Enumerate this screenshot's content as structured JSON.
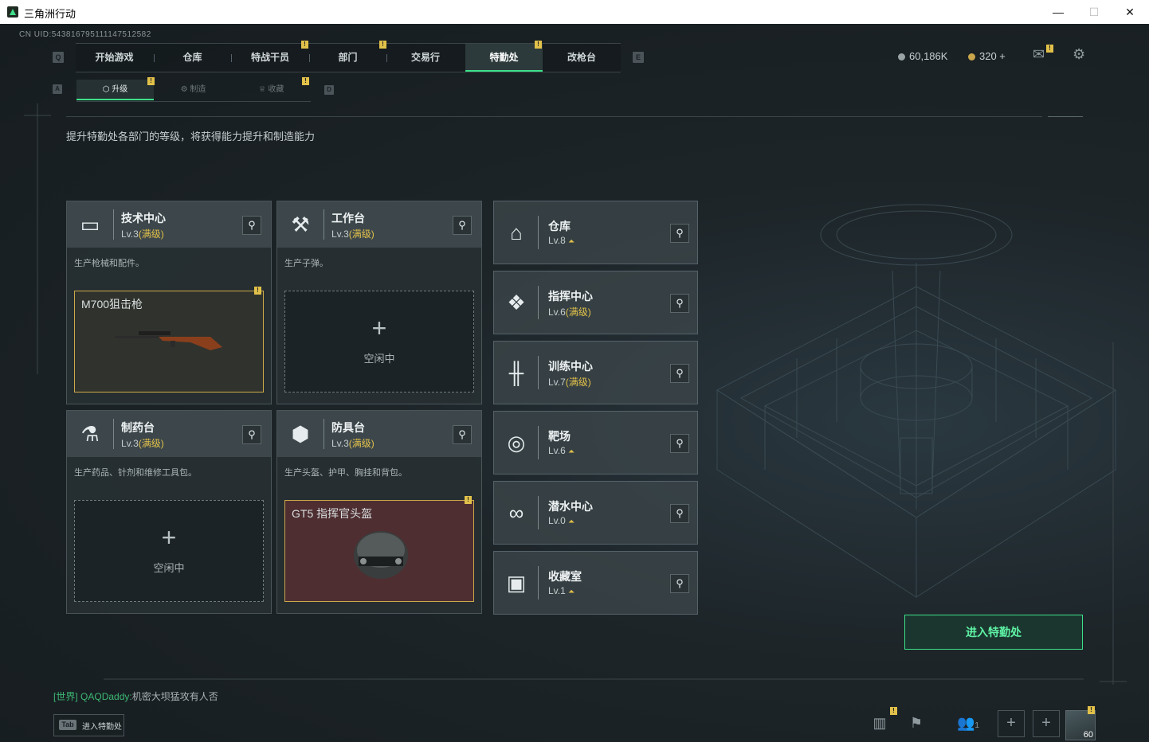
{
  "window": {
    "title": "三角洲行动",
    "minimize": "—",
    "maximize": "☐",
    "close": "✕"
  },
  "uid": "CN UID:543816795111147512582",
  "nav": {
    "left_key": "Q",
    "right_key": "E",
    "tabs": [
      {
        "label": "开始游戏"
      },
      {
        "label": "仓库"
      },
      {
        "label": "特战干员"
      },
      {
        "label": "部门"
      },
      {
        "label": "交易行"
      },
      {
        "label": "特勤处"
      },
      {
        "label": "改枪台"
      }
    ],
    "active": "特勤处"
  },
  "subnav": {
    "left_key": "A",
    "right_key": "D",
    "tabs": [
      {
        "label": "升级"
      },
      {
        "label": "制造"
      },
      {
        "label": "收藏"
      }
    ],
    "active": "升级"
  },
  "currency": {
    "silver": "60,186K",
    "gold": "320 +",
    "silver_color": "#9aa3a6",
    "gold_color": "#c9a64a"
  },
  "description": "提升特勤处各部门的等级，将获得能力提升和制造能力",
  "departments": [
    {
      "name": "技术中心",
      "level": "Lv.3",
      "max": "(满级)",
      "desc": "生产枪械和配件。",
      "icon": "computer-icon",
      "slot_state": "item",
      "slot_item": "M700狙击枪"
    },
    {
      "name": "工作台",
      "level": "Lv.3",
      "max": "(满级)",
      "desc": "生产子弹。",
      "icon": "tools-icon",
      "slot_state": "empty",
      "slot_idle": "空闲中"
    },
    {
      "name": "制药台",
      "level": "Lv.3",
      "max": "(满级)",
      "desc": "生产药品、针剂和维修工具包。",
      "icon": "microscope-icon",
      "slot_state": "empty",
      "slot_idle": "空闲中"
    },
    {
      "name": "防具台",
      "level": "Lv.3",
      "max": "(满级)",
      "desc": "生产头盔、护甲、胸挂和背包。",
      "icon": "armor-icon",
      "slot_state": "item",
      "slot_item": "GT5 指挥官头盔"
    }
  ],
  "facilities": [
    {
      "name": "仓库",
      "level": "Lv.8",
      "max": "",
      "icon": "warehouse-icon"
    },
    {
      "name": "指挥中心",
      "level": "Lv.6",
      "max": "(满级)",
      "icon": "command-icon"
    },
    {
      "name": "训练中心",
      "level": "Lv.7",
      "max": "(满级)",
      "icon": "dumbbell-icon"
    },
    {
      "name": "靶场",
      "level": "Lv.6",
      "max": "",
      "icon": "target-icon"
    },
    {
      "name": "潜水中心",
      "level": "Lv.0",
      "max": "",
      "icon": "diving-mask-icon"
    },
    {
      "name": "收藏室",
      "level": "Lv.1",
      "max": "",
      "icon": "collection-icon"
    }
  ],
  "enter_button": "进入特勤处",
  "chat": {
    "channel": "[世界]",
    "user": "QAQDaddy:",
    "message": "机密大坝猛攻有人否"
  },
  "tab_hint": {
    "key": "Tab",
    "label": "进入特勤处"
  },
  "bottom": {
    "friends_count": "1",
    "player_level": "60"
  },
  "badge_mark": "!"
}
